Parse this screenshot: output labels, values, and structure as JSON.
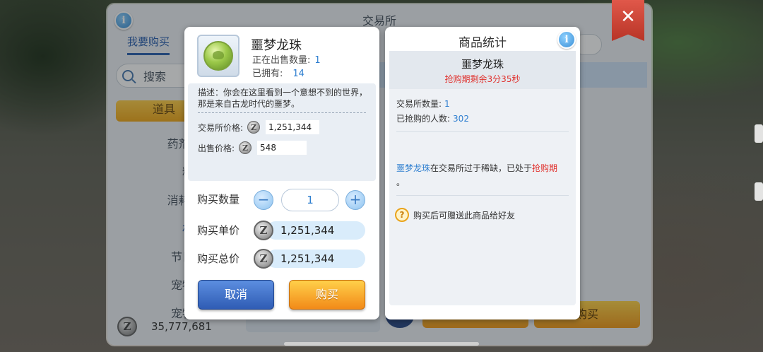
{
  "exchange": {
    "title": "交易所",
    "tab_label": "我要购买",
    "search_label": "搜索",
    "active_category": "道具",
    "categories": [
      "药剂/效",
      "精炼",
      "消耗品/",
      "材料",
      "节日材",
      "宠物材",
      "宠物头"
    ],
    "money": "35,777,681",
    "buy_label": "购买"
  },
  "buy_dialog": {
    "item_name": "噩梦龙珠",
    "on_sale_label": "正在出售数量:",
    "on_sale_value": "1",
    "owned_label": "已拥有:",
    "owned_value": "14",
    "description": "描述：你会在这里看到一个意想不到的世界，那是来自古龙时代的噩梦。",
    "exchange_price_label": "交易所价格:",
    "exchange_price_value": "1,251,344",
    "sell_price_label": "出售价格:",
    "sell_price_value": "548",
    "quantity_label": "购买数量",
    "quantity_value": "1",
    "minus": "−",
    "plus": "+",
    "unit_price_label": "购买单价",
    "unit_price_value": "1,251,344",
    "total_price_label": "购买总价",
    "total_price_value": "1,251,344",
    "cancel_label": "取消",
    "confirm_label": "购买"
  },
  "stats_dialog": {
    "title": "商品统计",
    "item_name": "噩梦龙珠",
    "timer_text": "抢购期剩余3分35秒",
    "exchange_count_label": "交易所数量:",
    "exchange_count_value": "1",
    "buyers_label": "已抢购的人数:",
    "buyers_value": "302",
    "msg_item": "噩梦龙珠",
    "msg_middle": "在交易所过于稀缺，已处于",
    "msg_status": "抢购期",
    "msg_end": "。",
    "gift_text": "购买后可赠送此商品给好友"
  },
  "icons": {
    "info": "i",
    "zeny": "Z",
    "close": "✕",
    "help": "?"
  },
  "colors": {
    "accent_blue": "#2f7fd0",
    "alert_red": "#e0302c",
    "buy_orange": "#f28a18",
    "cancel_blue": "#2f5cb4"
  }
}
